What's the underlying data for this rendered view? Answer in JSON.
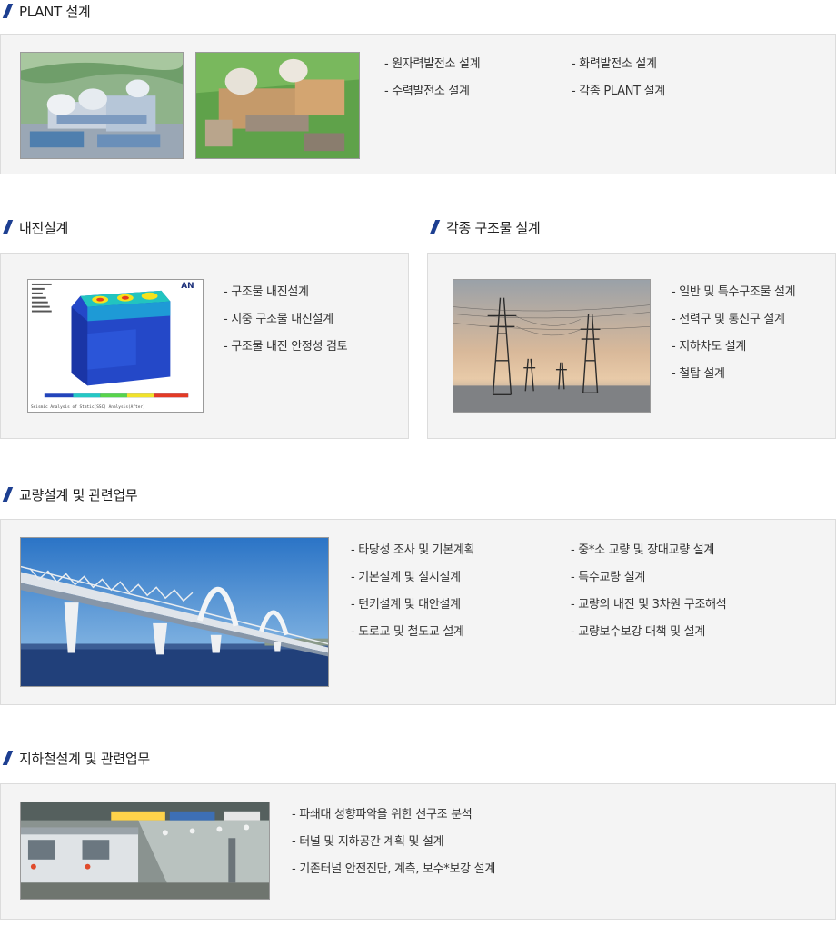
{
  "sections": {
    "plant": {
      "title": "PLANT 설계",
      "col1": [
        "- 원자력발전소 설계",
        "- 수력발전소 설계"
      ],
      "col2": [
        "- 화력발전소 설계",
        "- 각종 PLANT 설계"
      ]
    },
    "seismic": {
      "title": "내진설계",
      "items": [
        "- 구조물 내진설계",
        "- 지중 구조물 내진설계",
        "- 구조물 내진 안정성 검토"
      ],
      "image_text": {
        "logo": "AN",
        "footer": "Seismic Analysis of Static(SSC) Analysis(After)"
      }
    },
    "structures": {
      "title": "각종 구조물 설계",
      "items": [
        "- 일반 및 특수구조물 설계",
        "- 전력구 및 통신구 설계",
        "- 지하차도 설계",
        "- 철탑 설계"
      ]
    },
    "bridge": {
      "title": "교량설계 및 관련업무",
      "col1": [
        "- 타당성 조사 및 기본계획",
        "- 기본설계 및 실시설계",
        "- 턴키설계 및 대안설계",
        "- 도로교 및 철도교 설계"
      ],
      "col2": [
        "- 중*소 교량 및 장대교량 설계",
        "- 특수교량 설계",
        "- 교량의 내진 및 3차원 구조해석",
        "- 교량보수보강 대책 및 설계"
      ]
    },
    "subway": {
      "title": "지하철설계 및 관련업무",
      "items": [
        "- 파쇄대 성향파악을 위한 선구조 분석",
        "- 터널 및 지하공간 계획 및 설계",
        "- 기존터널 안전진단, 계측, 보수*보강 설계"
      ]
    }
  },
  "colors": {
    "accent": "#1d3f91",
    "box_bg": "#f4f4f4",
    "box_border": "#dcdcdc"
  }
}
